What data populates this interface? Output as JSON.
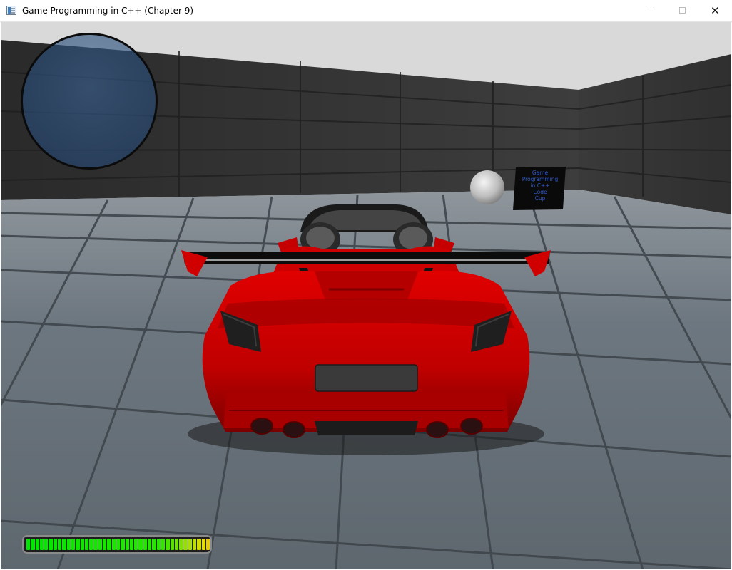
{
  "window": {
    "title": "Game Programming in C++ (Chapter 9)",
    "icon": "application-window-icon",
    "controls": {
      "minimize_icon": "minimize-icon",
      "maximize_icon": "maximize-icon",
      "close_symbol": "✕"
    }
  },
  "hud": {
    "radar_icon": "radar-circle",
    "radar_color": "#294f7f",
    "health_bar": {
      "segments": 50,
      "filled_fraction": 1.0,
      "colors_start": "#00e000",
      "colors_end": "#e00000"
    }
  },
  "scene": {
    "sky_color": "#d8d8d8",
    "wall_color": "#353535",
    "floor_color": "#6f7a82",
    "car_color": "#d40000",
    "sign_lines": [
      "Game",
      "Programming",
      "in C++",
      "Code",
      "Cup"
    ],
    "sphere_color": "#cfcfcf"
  }
}
